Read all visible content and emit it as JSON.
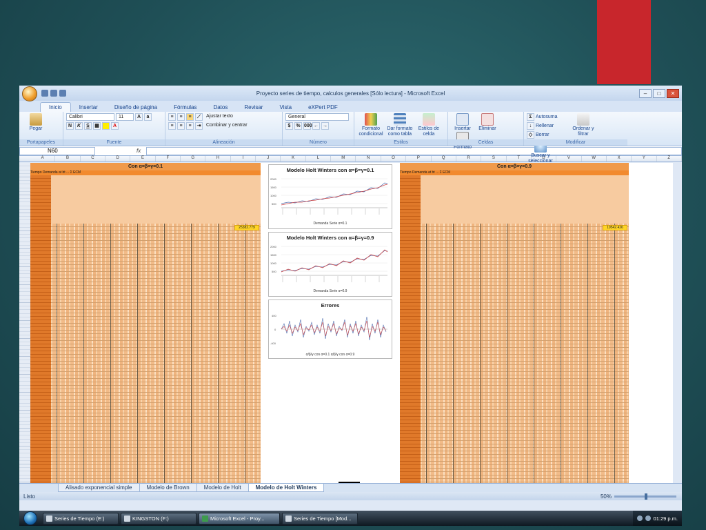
{
  "window": {
    "title": "Proyecto series de tiempo, calculos generales [Sólo lectura] - Microsoft Excel"
  },
  "ribbon_tabs": [
    "Inicio",
    "Insertar",
    "Diseño de página",
    "Fórmulas",
    "Datos",
    "Revisar",
    "Vista",
    "eXPert PDF"
  ],
  "ribbon": {
    "clipboard": {
      "paste": "Pegar",
      "label": "Portapapeles"
    },
    "font": {
      "name": "Calibri",
      "size": "11",
      "label": "Fuente"
    },
    "alignment": {
      "wrap": "Ajustar texto",
      "merge": "Combinar y centrar",
      "label": "Alineación"
    },
    "number": {
      "format": "General",
      "label": "Número"
    },
    "styles": {
      "conditional": "Formato condicional",
      "table": "Dar formato como tabla",
      "cell": "Estilos de celda",
      "label": "Estilos"
    },
    "cells": {
      "insert": "Insertar",
      "delete": "Eliminar",
      "format": "Formato",
      "label": "Celdas"
    },
    "editing": {
      "autosum": "Autosuma",
      "fill": "Rellenar",
      "clear": "Borrar",
      "sort": "Ordenar y filtrar",
      "find": "Buscar y seleccionar",
      "label": "Modificar"
    }
  },
  "formula_bar": {
    "name_box": "N60",
    "fx": "fx"
  },
  "columns": [
    "A",
    "B",
    "C",
    "D",
    "E",
    "F",
    "G",
    "H",
    "I",
    "J",
    "K",
    "L",
    "M",
    "N",
    "O",
    "P",
    "Q",
    "R",
    "S",
    "T",
    "U",
    "V",
    "W",
    "X",
    "Y",
    "Z"
  ],
  "blocks": [
    {
      "title": "Con α=β=γ=0.1",
      "header": "Tiempo  Demanda  at  bt  ...  Σ  ECM",
      "ecm": "25382.779"
    },
    {
      "title": "Con α=β=γ=0.9",
      "header": "Tiempo  Demanda  at  bt  ...  Σ  ECM",
      "ecm": "19542.426"
    }
  ],
  "charts": [
    {
      "title": "Modelo Holt Winters con α=β=γ=0.1",
      "legend": "Demanda    Serie α=0.1"
    },
    {
      "title": "Modelo Holt Winters con α=β=γ=0.9",
      "legend": "Demanda    Serie α=0.9"
    },
    {
      "title": "Errores",
      "legend": "α/β/γ con α=0.1    α/β/γ con α=0.9"
    }
  ],
  "sheet_tabs": [
    "Alisado exponencial simple",
    "Modelo de Brown",
    "Modelo de Holt",
    "Modelo de Holt Winters"
  ],
  "active_sheet": "Modelo de Holt Winters",
  "status": {
    "ready": "Listo",
    "zoom": "50%"
  },
  "taskbar": {
    "items": [
      "Series de Tiempo (E:)",
      "KINGSTON (F:)",
      "Microsoft Excel - Proy...",
      "Series de Tiempo [Mod..."
    ],
    "time": "01:29 p.m."
  }
}
